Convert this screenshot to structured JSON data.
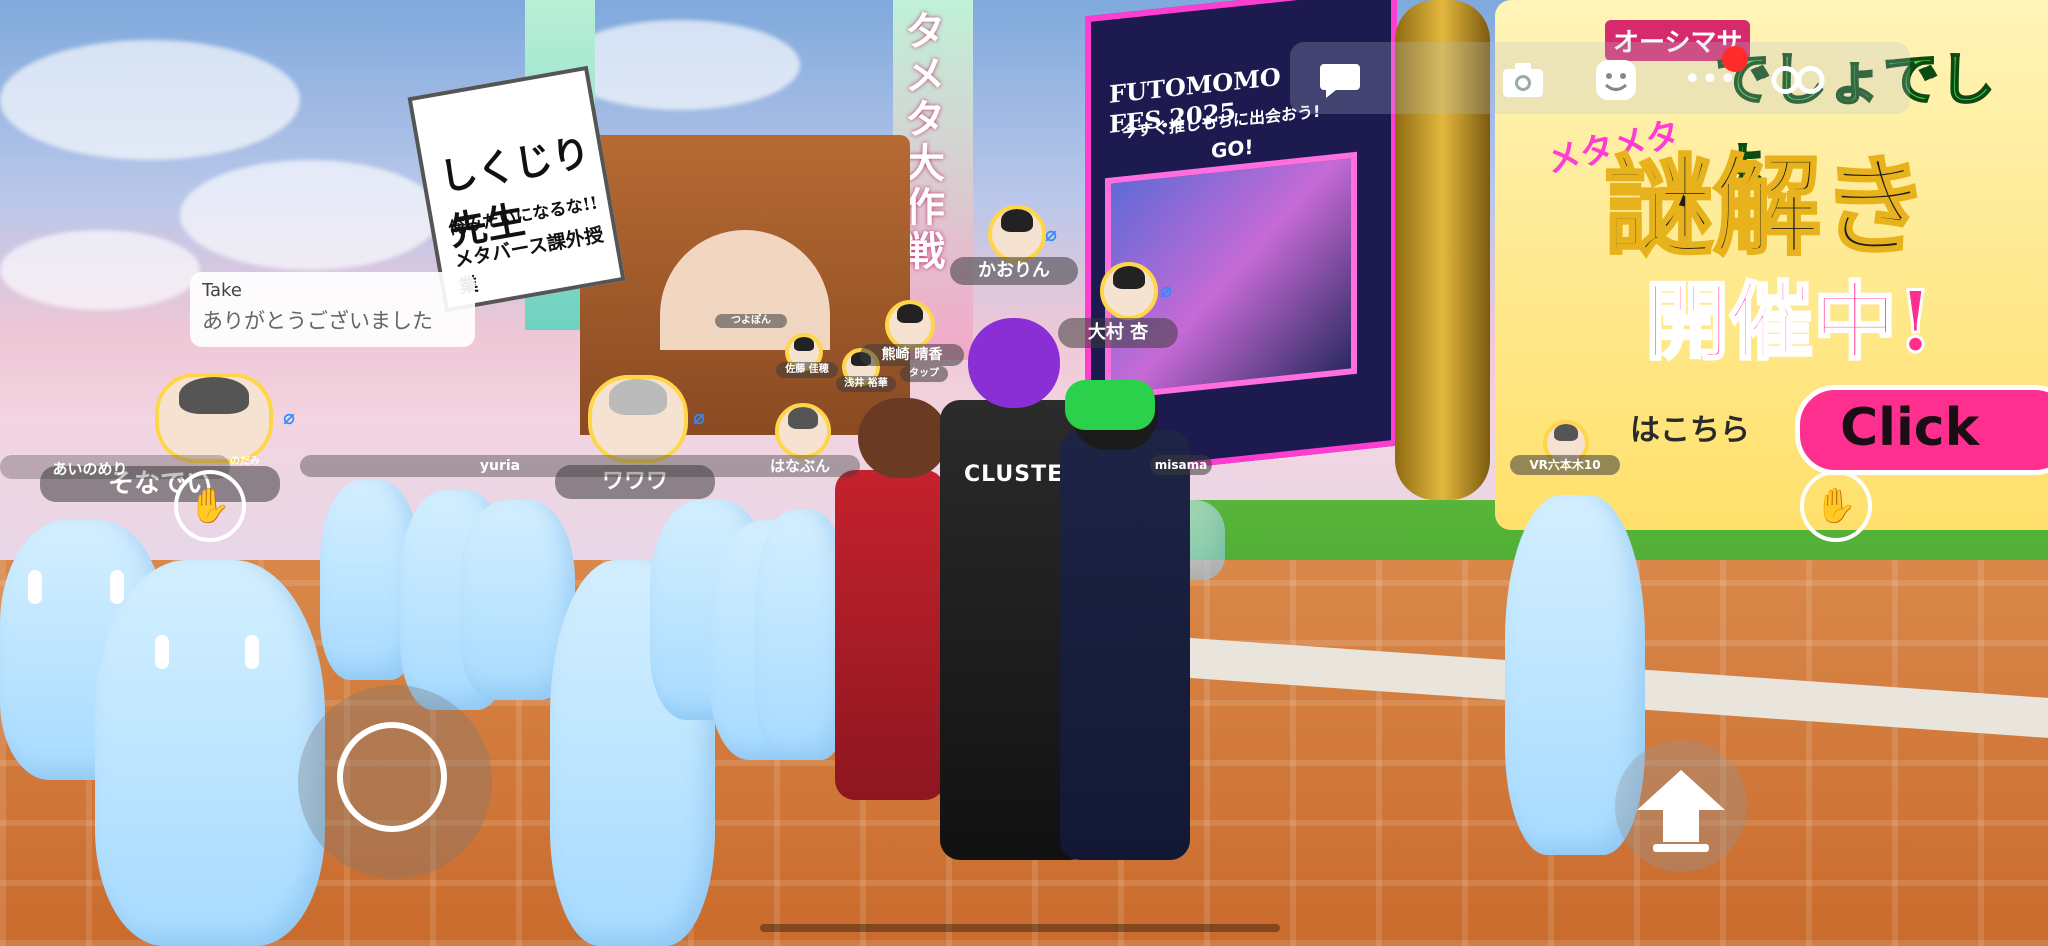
{
  "chat": {
    "user": "Take",
    "message": "ありがとうございました"
  },
  "nameplates": {
    "kaorin": "かおりん",
    "omura": "大村 杏",
    "kumazaki": "熊崎 晴香",
    "sato": "佐藤 佳穂",
    "asai": "浅井 裕華",
    "tappu": "タップ",
    "tsuyopon": "つよぽん",
    "sonade": "そなでい",
    "nodami": "のだみ",
    "aino": "あいのめり",
    "wawa": "ワワワ",
    "hanabun": "はなぶん",
    "yuria": "yuria",
    "misama": "misama",
    "roppongi": "VR六本木10"
  },
  "signs": {
    "kukujiri_title": "しくじり先生",
    "kukujiri_sub1": "俺みたいになるな!!",
    "kukujiri_sub2": "メタバース課外授業",
    "banner_vertical1": "タメタ大作戦",
    "fes_title": "FUTOMOMO FES.2025",
    "fes_sub": "今すぐ推しもちに出会おう!",
    "fes_go": "GO!",
    "ad_title1": "オーシマサ",
    "ad_title2": "でしょでしょ",
    "ad_meta": "メタメタ",
    "ad_main": "謎解き",
    "ad_open": "開催中!",
    "ad_here": "はこちら",
    "ad_click": "Click",
    "jacket": "CLUSTER"
  },
  "icons": {
    "chat": "chat-bubble-icon",
    "camera": "camera-icon",
    "emote": "smiley-icon",
    "more": "more-dots-icon",
    "glasses": "vr-glasses-icon",
    "jump": "jump-arrow-icon",
    "hand": "raise-hand-icon",
    "mic_off": "mic-off-icon"
  },
  "colors": {
    "accent_pink": "#ff3ed1",
    "record_red": "#ff2b2b",
    "mute_blue": "#2e8cff",
    "frame_yellow": "#ffd54a"
  }
}
